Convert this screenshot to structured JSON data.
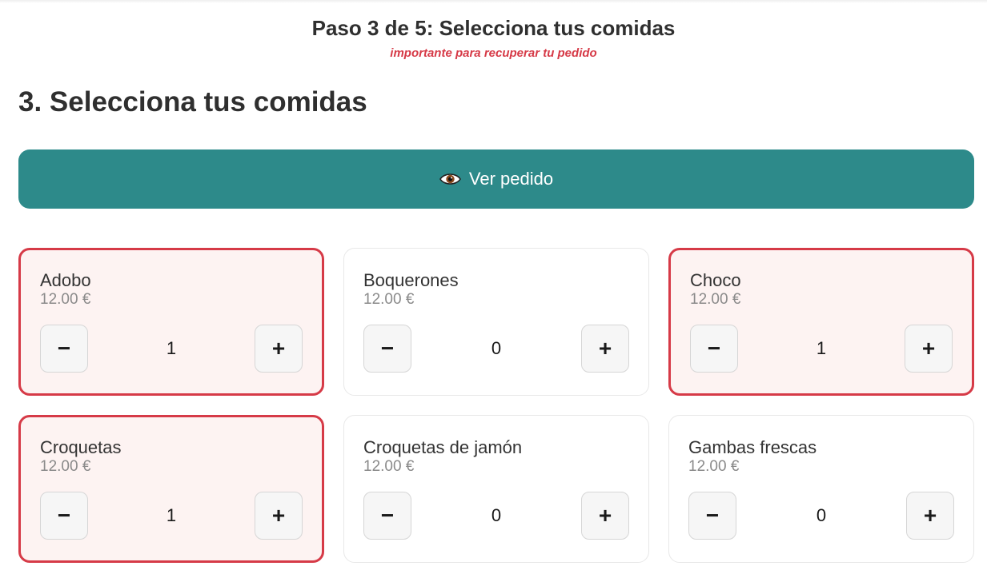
{
  "header": {
    "step_title": "Paso 3 de 5: Selecciona tus comidas",
    "note": "importante para recuperar tu pedido"
  },
  "section": {
    "title": "3. Selecciona tus comidas"
  },
  "view_order": {
    "label": "Ver pedido",
    "icon": "eye-icon"
  },
  "stepper": {
    "minus": "−",
    "plus": "+"
  },
  "colors": {
    "accent": "#2d8a8a",
    "selected_border": "#d63a47",
    "selected_bg": "#fdf3f2",
    "note": "#d63a47"
  },
  "items": [
    {
      "name": "Adobo",
      "price": "12.00 €",
      "quantity": "1",
      "selected": true
    },
    {
      "name": "Boquerones",
      "price": "12.00 €",
      "quantity": "0",
      "selected": false
    },
    {
      "name": "Choco",
      "price": "12.00 €",
      "quantity": "1",
      "selected": true
    },
    {
      "name": "Croquetas",
      "price": "12.00 €",
      "quantity": "1",
      "selected": true
    },
    {
      "name": "Croquetas de jamón",
      "price": "12.00 €",
      "quantity": "0",
      "selected": false
    },
    {
      "name": "Gambas frescas",
      "price": "12.00 €",
      "quantity": "0",
      "selected": false
    }
  ]
}
